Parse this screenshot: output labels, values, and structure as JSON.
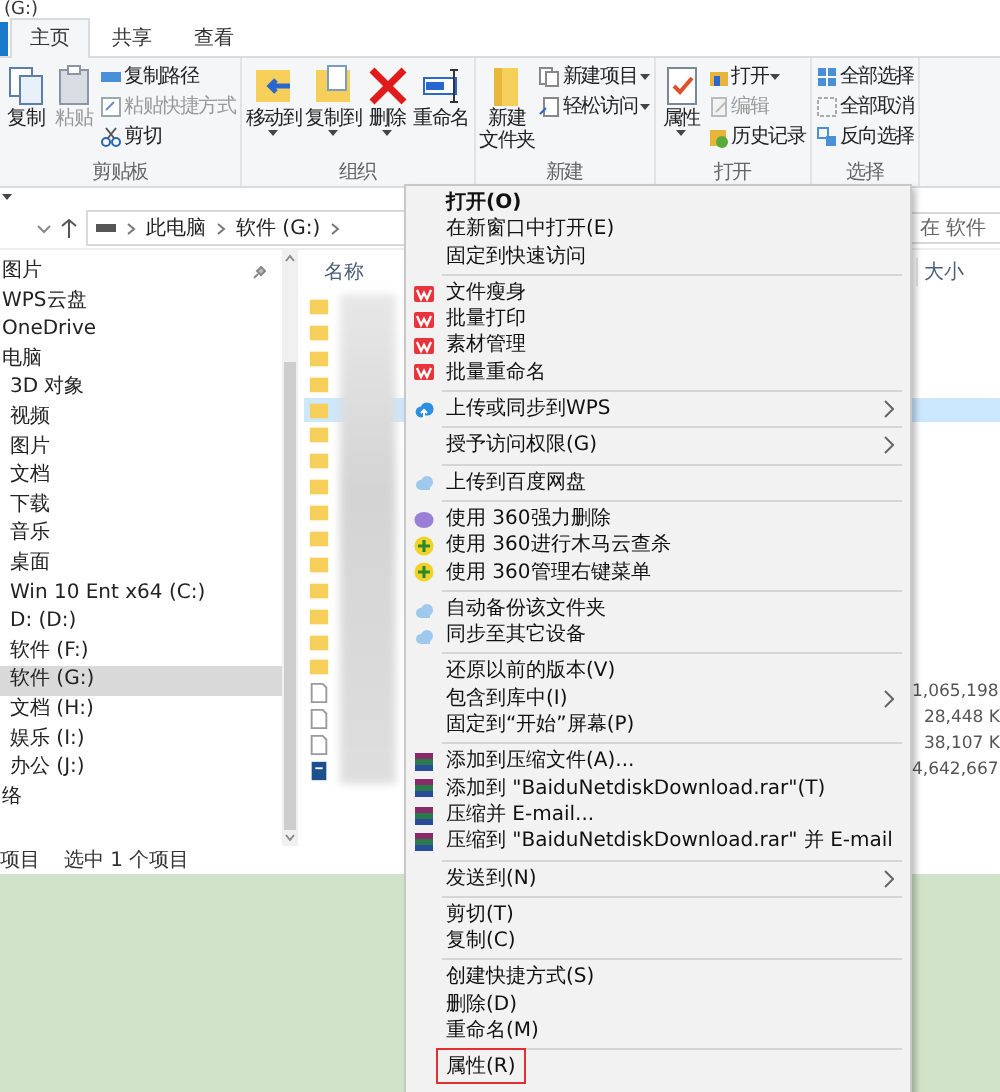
{
  "window": {
    "title": "(G:)"
  },
  "ribbon_tabs": [
    {
      "label": "主页",
      "selected": true
    },
    {
      "label": "共享",
      "selected": false
    },
    {
      "label": "查看",
      "selected": false
    }
  ],
  "ribbon_groups": [
    {
      "label": "剪贴板",
      "items": [
        {
          "kind": "large",
          "label": "复制",
          "dropdown": false,
          "disabled": false
        },
        {
          "kind": "large",
          "label": "粘贴",
          "dropdown": false,
          "disabled": true
        },
        {
          "kind": "small",
          "label": "复制路径",
          "dropdown": false,
          "disabled": false
        },
        {
          "kind": "small",
          "label": "粘贴快捷方式",
          "dropdown": false,
          "disabled": true
        },
        {
          "kind": "small",
          "label": "剪切",
          "dropdown": false,
          "disabled": false
        }
      ]
    },
    {
      "label": "组织",
      "items": [
        {
          "kind": "large",
          "label": "移动到",
          "dropdown": true,
          "disabled": false
        },
        {
          "kind": "large",
          "label": "复制到",
          "dropdown": true,
          "disabled": false
        },
        {
          "kind": "large",
          "label": "删除",
          "dropdown": true,
          "disabled": false
        },
        {
          "kind": "large",
          "label": "重命名",
          "dropdown": false,
          "disabled": false
        }
      ]
    },
    {
      "label": "新建",
      "items": [
        {
          "kind": "large",
          "lines": [
            "新建",
            "文件夹"
          ],
          "dropdown": false,
          "disabled": false
        },
        {
          "kind": "small",
          "label": "新建项目",
          "dropdown": true,
          "disabled": false
        },
        {
          "kind": "small",
          "label": "轻松访问",
          "dropdown": true,
          "disabled": false
        }
      ]
    },
    {
      "label": "打开",
      "items": [
        {
          "kind": "large",
          "label": "属性",
          "dropdown": true,
          "disabled": false
        },
        {
          "kind": "small",
          "label": "打开",
          "dropdown": true,
          "disabled": false
        },
        {
          "kind": "small",
          "label": "编辑",
          "dropdown": false,
          "disabled": true
        },
        {
          "kind": "small",
          "label": "历史记录",
          "dropdown": false,
          "disabled": false
        }
      ]
    },
    {
      "label": "选择",
      "items": [
        {
          "kind": "small",
          "label": "全部选择",
          "dropdown": false,
          "disabled": false
        },
        {
          "kind": "small",
          "label": "全部取消",
          "dropdown": false,
          "disabled": false
        },
        {
          "kind": "small",
          "label": "反向选择",
          "dropdown": false,
          "disabled": false
        }
      ]
    }
  ],
  "address": {
    "crumbs": [
      "此电脑",
      "软件 (G:)"
    ],
    "search": {
      "placeholder": "在 软件"
    }
  },
  "nav": {
    "items": [
      {
        "label": "图片",
        "pinned": true,
        "selected": false
      },
      {
        "label": "WPS云盘",
        "pinned": false,
        "selected": false
      },
      {
        "label": "OneDrive",
        "pinned": false,
        "selected": false
      },
      {
        "label": "电脑",
        "pinned": false,
        "selected": false,
        "children": [
          {
            "label": "3D 对象",
            "selected": false
          },
          {
            "label": "视频",
            "selected": false
          },
          {
            "label": "图片",
            "selected": false
          },
          {
            "label": "文档",
            "selected": false
          },
          {
            "label": "下载",
            "selected": false
          },
          {
            "label": "音乐",
            "selected": false
          },
          {
            "label": "桌面",
            "selected": false
          },
          {
            "label": "Win 10 Ent x64 (C:)",
            "selected": false
          },
          {
            "label": "D: (D:)",
            "selected": false
          },
          {
            "label": "软件 (F:)",
            "selected": false
          },
          {
            "label": "软件 (G:)",
            "selected": true
          },
          {
            "label": "文档 (H:)",
            "selected": false
          },
          {
            "label": "娱乐 (I:)",
            "selected": false
          },
          {
            "label": "办公 (J:)",
            "selected": false
          }
        ]
      },
      {
        "label": "络",
        "pinned": false,
        "selected": false
      }
    ]
  },
  "files": {
    "columns": [
      "名称",
      "大小"
    ],
    "rows": [
      {
        "kind": "folder",
        "selected": false
      },
      {
        "kind": "folder",
        "selected": false
      },
      {
        "kind": "folder",
        "selected": false
      },
      {
        "kind": "folder",
        "selected": false
      },
      {
        "kind": "folder",
        "selected": true
      },
      {
        "kind": "folder",
        "selected": false
      },
      {
        "kind": "folder",
        "selected": false
      },
      {
        "kind": "folder",
        "selected": false
      },
      {
        "kind": "folder",
        "selected": false
      },
      {
        "kind": "folder",
        "selected": false
      },
      {
        "kind": "folder",
        "selected": false
      },
      {
        "kind": "folder",
        "selected": false
      },
      {
        "kind": "folder",
        "selected": false
      },
      {
        "kind": "folder",
        "selected": false
      },
      {
        "kind": "folder",
        "selected": false
      },
      {
        "kind": "file",
        "selected": false,
        "size": "1,065,198,"
      },
      {
        "kind": "file",
        "selected": false,
        "size": "28,448 K"
      },
      {
        "kind": "file",
        "selected": false,
        "size": "38,107 K"
      },
      {
        "kind": "document",
        "selected": false,
        "size": "4,642,667."
      }
    ]
  },
  "status_bar": [
    "项目",
    "选中 1 个项目"
  ],
  "context_menu": {
    "groups": [
      [
        {
          "label": "打开(O)",
          "default": true,
          "submenu": false,
          "marked": false
        },
        {
          "label": "在新窗口中打开(E)",
          "default": false,
          "submenu": false,
          "marked": false
        },
        {
          "label": "固定到快速访问",
          "default": false,
          "submenu": false,
          "marked": false
        }
      ],
      [
        {
          "label": "文件瘦身",
          "default": false,
          "submenu": false,
          "marked": false
        },
        {
          "label": "批量打印",
          "default": false,
          "submenu": false,
          "marked": false
        },
        {
          "label": "素材管理",
          "default": false,
          "submenu": false,
          "marked": false
        },
        {
          "label": "批量重命名",
          "default": false,
          "submenu": false,
          "marked": false
        }
      ],
      [
        {
          "label": "上传或同步到WPS",
          "default": false,
          "submenu": true,
          "marked": false
        }
      ],
      [
        {
          "label": "授予访问权限(G)",
          "default": false,
          "submenu": true,
          "marked": false
        }
      ],
      [
        {
          "label": "上传到百度网盘",
          "default": false,
          "submenu": false,
          "marked": false
        }
      ],
      [
        {
          "label": "使用 360强力删除",
          "default": false,
          "submenu": false,
          "marked": false
        },
        {
          "label": "使用 360进行木马云查杀",
          "default": false,
          "submenu": false,
          "marked": false
        },
        {
          "label": "使用 360管理右键菜单",
          "default": false,
          "submenu": false,
          "marked": false
        }
      ],
      [
        {
          "label": "自动备份该文件夹",
          "default": false,
          "submenu": false,
          "marked": false
        },
        {
          "label": "同步至其它设备",
          "default": false,
          "submenu": false,
          "marked": false
        }
      ],
      [
        {
          "label": "还原以前的版本(V)",
          "default": false,
          "submenu": false,
          "marked": false
        },
        {
          "label": "包含到库中(I)",
          "default": false,
          "submenu": true,
          "marked": false
        },
        {
          "label": "固定到“开始”屏幕(P)",
          "default": false,
          "submenu": false,
          "marked": false
        }
      ],
      [
        {
          "label": "添加到压缩文件(A)...",
          "default": false,
          "submenu": false,
          "marked": false
        },
        {
          "label": "添加到 \"BaiduNetdiskDownload.rar\"(T)",
          "default": false,
          "submenu": false,
          "marked": false
        },
        {
          "label": "压缩并 E-mail...",
          "default": false,
          "submenu": false,
          "marked": false
        },
        {
          "label": "压缩到 \"BaiduNetdiskDownload.rar\" 并 E-mail",
          "default": false,
          "submenu": false,
          "marked": false
        }
      ],
      [
        {
          "label": "发送到(N)",
          "default": false,
          "submenu": true,
          "marked": false
        }
      ],
      [
        {
          "label": "剪切(T)",
          "default": false,
          "submenu": false,
          "marked": false
        },
        {
          "label": "复制(C)",
          "default": false,
          "submenu": false,
          "marked": false
        }
      ],
      [
        {
          "label": "创建快捷方式(S)",
          "default": false,
          "submenu": false,
          "marked": false
        },
        {
          "label": "删除(D)",
          "default": false,
          "submenu": false,
          "marked": false
        },
        {
          "label": "重命名(M)",
          "default": false,
          "submenu": false,
          "marked": false
        }
      ],
      [
        {
          "label": "属性(R)",
          "default": false,
          "submenu": false,
          "marked": true
        }
      ]
    ]
  }
}
